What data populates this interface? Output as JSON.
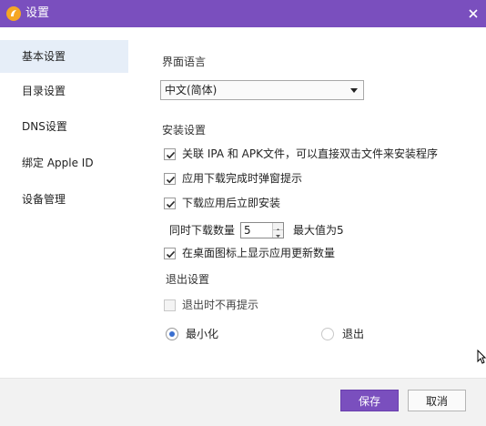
{
  "window": {
    "title": "设置",
    "accent": "#7a4fbe"
  },
  "sidebar": {
    "items": [
      {
        "label": "基本设置",
        "active": true
      },
      {
        "label": "目录设置",
        "active": false
      },
      {
        "label": "DNS设置",
        "active": false
      },
      {
        "label": "绑定 Apple ID",
        "active": false
      },
      {
        "label": "设备管理",
        "active": false
      }
    ]
  },
  "main": {
    "language_section": "界面语言",
    "language_select": {
      "value": "中文(简体)"
    },
    "install_section": "安装设置",
    "options": [
      {
        "label": "关联 IPA 和 APK文件，可以直接双击文件来安装程序",
        "checked": true
      },
      {
        "label": "应用下载完成时弹窗提示",
        "checked": true
      },
      {
        "label": "下载应用后立即安装",
        "checked": true
      }
    ],
    "concurrent": {
      "label": "同时下载数量",
      "value": "5",
      "max_note": "最大值为5"
    },
    "desktop_badge": {
      "label": "在桌面图标上显示应用更新数量",
      "checked": true
    },
    "exit_section": "退出设置",
    "exit_no_prompt": {
      "label": "退出时不再提示",
      "checked": false
    },
    "exit_choices": [
      {
        "label": "最小化",
        "selected": true
      },
      {
        "label": "退出",
        "selected": false
      }
    ]
  },
  "footer": {
    "save_label": "保存",
    "cancel_label": "取消"
  }
}
